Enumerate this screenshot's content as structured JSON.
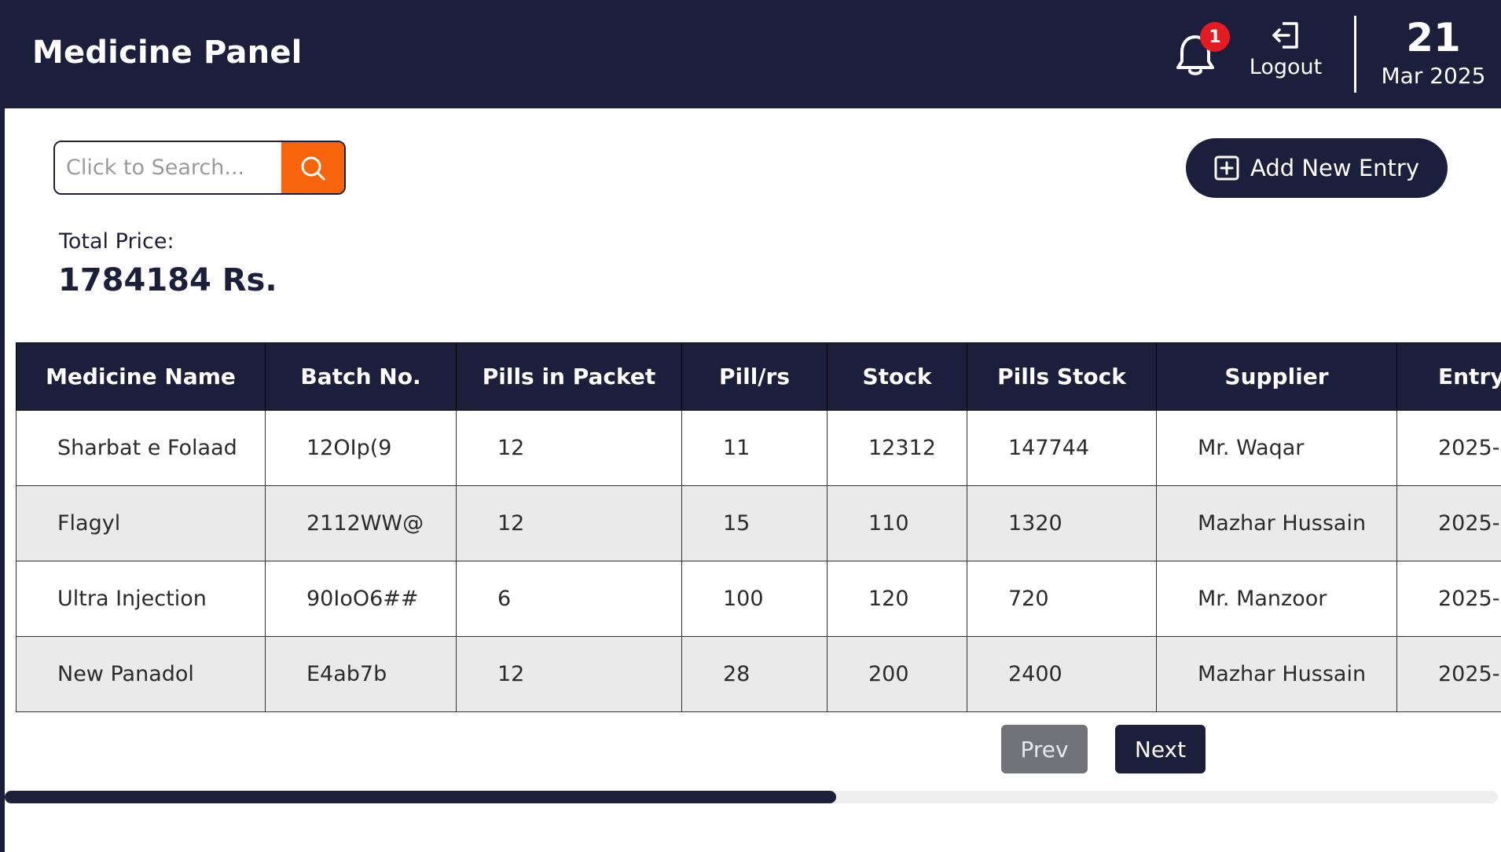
{
  "header": {
    "title": "Medicine Panel",
    "notification_count": "1",
    "logout_label": "Logout",
    "date_day": "21",
    "date_month_year": "Mar 2025"
  },
  "search": {
    "placeholder": "Click to Search...",
    "value": ""
  },
  "add_button_label": "Add New Entry",
  "total": {
    "label": "Total Price:",
    "value": "1784184 Rs."
  },
  "table": {
    "columns": [
      "Medicine Name",
      "Batch No.",
      "Pills in Packet",
      "Pill/rs",
      "Stock",
      "Pills Stock",
      "Supplier",
      "Entry"
    ],
    "rows": [
      [
        "Sharbat e Folaad",
        "12OIp(9",
        "12",
        "11",
        "12312",
        "147744",
        "Mr. Waqar",
        "2025-"
      ],
      [
        "Flagyl",
        "2112WW@",
        "12",
        "15",
        "110",
        "1320",
        "Mazhar Hussain",
        "2025-"
      ],
      [
        "Ultra Injection",
        "90IoO6##",
        "6",
        "100",
        "120",
        "720",
        "Mr. Manzoor",
        "2025-"
      ],
      [
        "New Panadol",
        "E4ab7b",
        "12",
        "28",
        "200",
        "2400",
        "Mazhar Hussain",
        "2025-"
      ]
    ]
  },
  "pagination": {
    "prev_label": "Prev",
    "next_label": "Next"
  },
  "scrollbar": {
    "thumb_fraction": 0.557
  },
  "colors": {
    "navy": "#1c1f3b",
    "accent_orange": "#f7640c",
    "badge_red": "#e31b23",
    "row_alt": "#eaeaea"
  },
  "icons": {
    "notification": "bell-icon",
    "logout": "logout-icon",
    "search": "search-icon",
    "add": "plus-square-icon"
  }
}
